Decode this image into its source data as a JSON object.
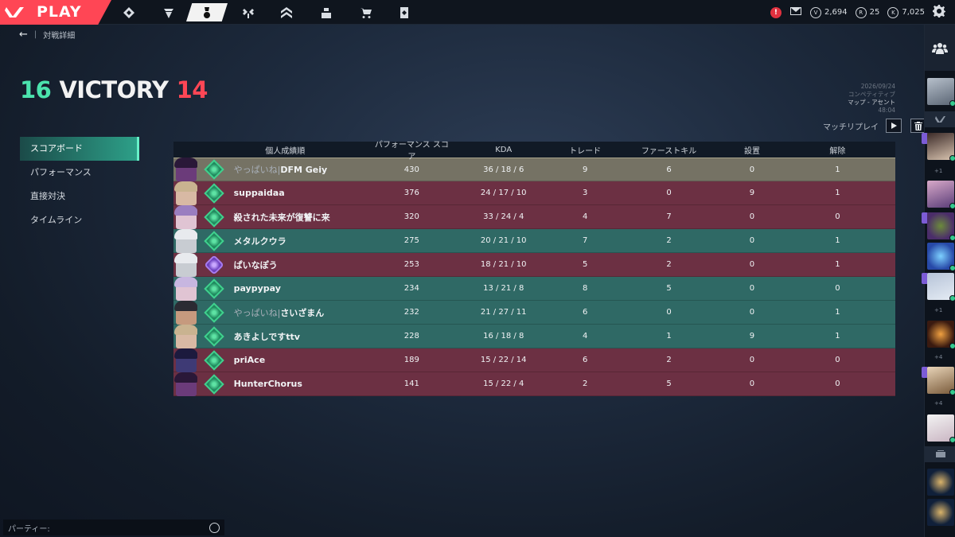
{
  "topbar": {
    "play_label": "PLAY",
    "nav_items": [
      "career-icon",
      "battlepass-icon",
      "collection-icon",
      "agents-icon",
      "rank-icon",
      "social-icon",
      "store-icon",
      "cards-icon"
    ],
    "alert_label": "!",
    "currencies": [
      {
        "badge": "V",
        "value": "2,694"
      },
      {
        "badge": "R",
        "value": "25"
      },
      {
        "badge": "K",
        "value": "7,025"
      }
    ]
  },
  "breadcrumb": {
    "separator": "|",
    "label": "対戦詳細"
  },
  "score": {
    "win": "16",
    "result": "VICTORY",
    "loss": "14"
  },
  "match_info": {
    "date": "2026/09/24",
    "mode": "コンペティティブ",
    "map": "マップ - アセント",
    "duration": "48:04"
  },
  "replay": {
    "label": "マッチリプレイ"
  },
  "leftnav": {
    "items": [
      "スコアボード",
      "パフォーマンス",
      "直接対決",
      "タイムライン"
    ]
  },
  "table": {
    "headers": {
      "name": "個人成績順",
      "acs": "パフォーマンス スコア",
      "kda": "KDA",
      "trade": "トレード",
      "first_kill": "ファーストキル",
      "plant": "設置",
      "defuse": "解除"
    },
    "rows": [
      {
        "team": "self",
        "prefix": "やっぱいね|",
        "name": "DFM Geiy",
        "acs": "430",
        "kda": "36 / 18 / 6",
        "trade": "9",
        "fk": "6",
        "plant": "0",
        "defuse": "1",
        "rank": "green",
        "agent": "#6b3b7a",
        "hair": "#2a1838"
      },
      {
        "team": "red",
        "prefix": "",
        "name": "suppaidaa",
        "acs": "376",
        "kda": "24 / 17 / 10",
        "trade": "3",
        "fk": "0",
        "plant": "9",
        "defuse": "1",
        "rank": "green",
        "agent": "#d8b9a4",
        "hair": "#c9b390"
      },
      {
        "team": "red",
        "prefix": "",
        "name": "殺された未来が復讐に来",
        "acs": "320",
        "kda": "33 / 24 / 4",
        "trade": "4",
        "fk": "7",
        "plant": "0",
        "defuse": "0",
        "rank": "green",
        "agent": "#e0c4d3",
        "hair": "#9a7ec0"
      },
      {
        "team": "green",
        "prefix": "",
        "name": "メタルクウラ",
        "acs": "275",
        "kda": "20 / 21 / 10",
        "trade": "7",
        "fk": "2",
        "plant": "0",
        "defuse": "1",
        "rank": "green",
        "agent": "#c8ccd2",
        "hair": "#e8eaee"
      },
      {
        "team": "red",
        "prefix": "",
        "name": "ぱいなぽう",
        "acs": "253",
        "kda": "18 / 21 / 10",
        "trade": "5",
        "fk": "2",
        "plant": "0",
        "defuse": "1",
        "rank": "purple",
        "agent": "#c8ccd2",
        "hair": "#e8eaee"
      },
      {
        "team": "green",
        "prefix": "",
        "name": "paypypay",
        "acs": "234",
        "kda": "13 / 21 / 8",
        "trade": "8",
        "fk": "5",
        "plant": "0",
        "defuse": "0",
        "rank": "green",
        "agent": "#e0c4d3",
        "hair": "#c7b6e0"
      },
      {
        "team": "green",
        "prefix": "やっぱいね|",
        "name": "さいざまん",
        "acs": "232",
        "kda": "21 / 27 / 11",
        "trade": "6",
        "fk": "0",
        "plant": "0",
        "defuse": "1",
        "rank": "green",
        "agent": "#c69a7e",
        "hair": "#2b2b33"
      },
      {
        "team": "green",
        "prefix": "",
        "name": "あきよしですttv",
        "acs": "228",
        "kda": "16 / 18 / 8",
        "trade": "4",
        "fk": "1",
        "plant": "9",
        "defuse": "1",
        "rank": "green",
        "agent": "#d8b9a4",
        "hair": "#c9b390"
      },
      {
        "team": "red",
        "prefix": "",
        "name": "priAce",
        "acs": "189",
        "kda": "15 / 22 / 14",
        "trade": "6",
        "fk": "2",
        "plant": "0",
        "defuse": "0",
        "rank": "green",
        "agent": "#3e3a75",
        "hair": "#1c1a3e"
      },
      {
        "team": "red",
        "prefix": "",
        "name": "HunterChorus",
        "acs": "141",
        "kda": "15 / 22 / 4",
        "trade": "2",
        "fk": "5",
        "plant": "0",
        "defuse": "0",
        "rank": "green",
        "agent": "#6b3b7a",
        "hair": "#2a1838"
      }
    ]
  },
  "rail": {
    "plus_labels": [
      "+1",
      "+1",
      "+4",
      "+4"
    ]
  },
  "party": {
    "label": "パーティー:"
  },
  "colors": {
    "accent_green": "#4be3ad",
    "accent_red": "#ff4655",
    "row_green": "#2f6965",
    "row_red": "#6c3043",
    "row_self": "#757264"
  }
}
